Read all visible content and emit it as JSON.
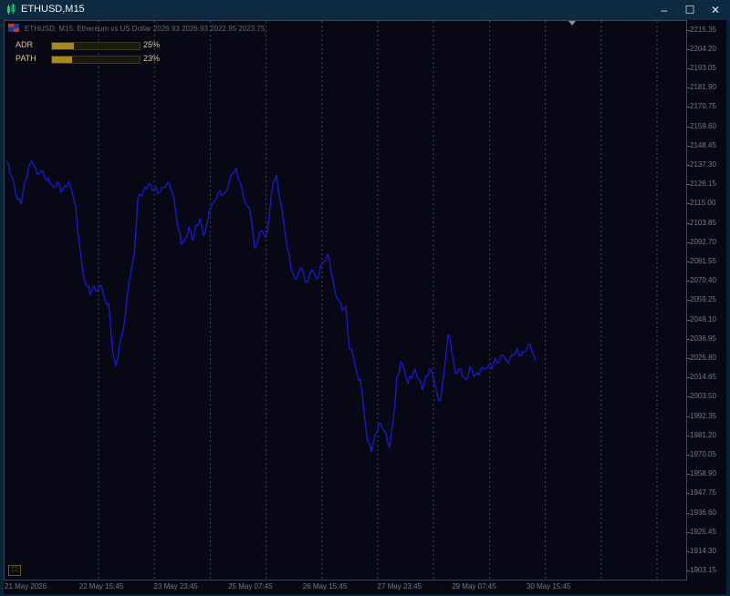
{
  "window": {
    "title": "ETHUSD,M15",
    "minimize_glyph": "–",
    "maximize_glyph": "☐",
    "close_glyph": "✕"
  },
  "chart": {
    "header": "ETHUSD, M15:  Ethereum vs US Dollar  2026.93 2026.93 2022.95 2023.75",
    "background": "#070814",
    "line_color": "#1a1ae6",
    "grid_color": "#3a4a5a",
    "corner_button_glyph": "⛶"
  },
  "indicators": [
    {
      "label": "ADR",
      "value_text": "25%",
      "fraction": 0.25
    },
    {
      "label": "PATH",
      "value_text": "23%",
      "fraction": 0.23
    }
  ],
  "price_axis": {
    "labels": [
      "2215.35",
      "2204.20",
      "2193.05",
      "2181.90",
      "2170.75",
      "2159.60",
      "2148.45",
      "2137.30",
      "2126.15",
      "2115.00",
      "2103.85",
      "2092.70",
      "2081.55",
      "2070.40",
      "2059.25",
      "2048.10",
      "2036.95",
      "2025.80",
      "2014.65",
      "2003.50",
      "1992.35",
      "1981.20",
      "1970.05",
      "1958.90",
      "1947.75",
      "1936.60",
      "1925.45",
      "1914.30",
      "1903.15"
    ]
  },
  "time_axis": {
    "labels": [
      "21 May 2026",
      "22 May 15:45",
      "23 May 23:45",
      "25 May 07:45",
      "26 May 15:45",
      "27 May 23:45",
      "29 May 07:45",
      "30 May 15:45"
    ]
  },
  "chart_data": {
    "type": "line",
    "series": [
      {
        "x_index": [
          0,
          4,
          8,
          12,
          16,
          20,
          24,
          28,
          32,
          36,
          40,
          44,
          48,
          52,
          56,
          60,
          64,
          68,
          72,
          76,
          80,
          84,
          88,
          92,
          96,
          100,
          104,
          108,
          112,
          116,
          120,
          124,
          128,
          132,
          136,
          140,
          144,
          148,
          152,
          156,
          160,
          164,
          168,
          172,
          176,
          180,
          184,
          188,
          192,
          196,
          200,
          204,
          208,
          212,
          216,
          220,
          224,
          228,
          232,
          236,
          240,
          244,
          248,
          252,
          256,
          260,
          264,
          268,
          272,
          276,
          280,
          284,
          288,
          292,
          296,
          300,
          304,
          308,
          312,
          316,
          320,
          324,
          328,
          332,
          336,
          340,
          344,
          348,
          352,
          356,
          360,
          364,
          368,
          372,
          376,
          380,
          384,
          388,
          392,
          396,
          400,
          404,
          408,
          412,
          416,
          420,
          424,
          428,
          432,
          436,
          440,
          444,
          448,
          452,
          456,
          460,
          464,
          468,
          472,
          476,
          480,
          484,
          488,
          492,
          496,
          500,
          504,
          508,
          512,
          516,
          520,
          524,
          528,
          532,
          536,
          540,
          544,
          548,
          552,
          556,
          560,
          564,
          568,
          572,
          576,
          580,
          584,
          588,
          592,
          596,
          600,
          604,
          608,
          612,
          616,
          620
        ],
        "values": [
          2140,
          2133,
          2128,
          2118,
          2115,
          2128,
          2135,
          2140,
          2136,
          2133,
          2134,
          2129,
          2127,
          2125,
          2128,
          2122,
          2126,
          2128,
          2122,
          2114,
          2092,
          2075,
          2068,
          2063,
          2068,
          2065,
          2068,
          2060,
          2058,
          2032,
          2022,
          2034,
          2042,
          2060,
          2074,
          2086,
          2118,
          2120,
          2125,
          2127,
          2123,
          2125,
          2122,
          2125,
          2127,
          2124,
          2118,
          2102,
          2092,
          2095,
          2102,
          2094,
          2103,
          2107,
          2097,
          2104,
          2113,
          2117,
          2122,
          2120,
          2122,
          2128,
          2133,
          2136,
          2128,
          2119,
          2114,
          2108,
          2090,
          2095,
          2100,
          2096,
          2108,
          2127,
          2132,
          2118,
          2104,
          2090,
          2078,
          2072,
          2075,
          2078,
          2070,
          2074,
          2077,
          2072,
          2079,
          2082,
          2086,
          2076,
          2065,
          2060,
          2054,
          2056,
          2032,
          2028,
          2018,
          2014,
          1995,
          1978,
          1972,
          1982,
          1988,
          1986,
          1983,
          1975,
          1990,
          2015,
          2024,
          2020,
          2012,
          2015,
          2020,
          2014,
          2008,
          2016,
          2020,
          2015,
          2006,
          2002,
          2020,
          2040,
          2030,
          2018,
          2020,
          2016,
          2014,
          2021,
          2016,
          2018,
          2020,
          2020,
          2022,
          2020,
          2026,
          2024,
          2028,
          2025,
          2026,
          2028,
          2032,
          2028,
          2030,
          2034,
          2030,
          2025
        ],
        "color": "#1a1ae6"
      }
    ],
    "ylim": [
      1897.5,
      2220.9
    ],
    "grid": true
  }
}
